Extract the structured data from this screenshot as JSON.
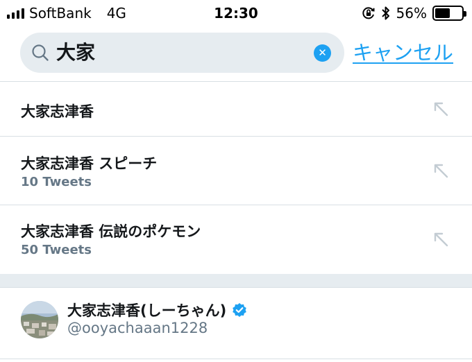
{
  "status_bar": {
    "carrier": "SoftBank",
    "network": "4G",
    "time": "12:30",
    "battery": "56%",
    "battery_level": 0.56,
    "icons": [
      "signal-icon",
      "orientation-lock-icon",
      "bluetooth-icon",
      "battery-icon"
    ]
  },
  "search": {
    "query": "大家",
    "clear_icon": "clear-icon",
    "cancel_label": "キャンセル"
  },
  "suggestions": [
    {
      "text": "大家志津香",
      "count": "",
      "icon": "arrow-up-left-icon"
    },
    {
      "text": "大家志津香 スピーチ",
      "count": "10 Tweets",
      "icon": "arrow-up-left-icon"
    },
    {
      "text": "大家志津香 伝説のポケモン",
      "count": "50 Tweets",
      "icon": "arrow-up-left-icon"
    }
  ],
  "user": {
    "name": "大家志津香(しーちゃん)",
    "handle": "@ooyachaaan1228",
    "verified": true
  },
  "colors": {
    "accent": "#1da1f2",
    "secondary_text": "#657786",
    "search_bg": "#e6ecf0",
    "divider": "#d8dfe4"
  }
}
